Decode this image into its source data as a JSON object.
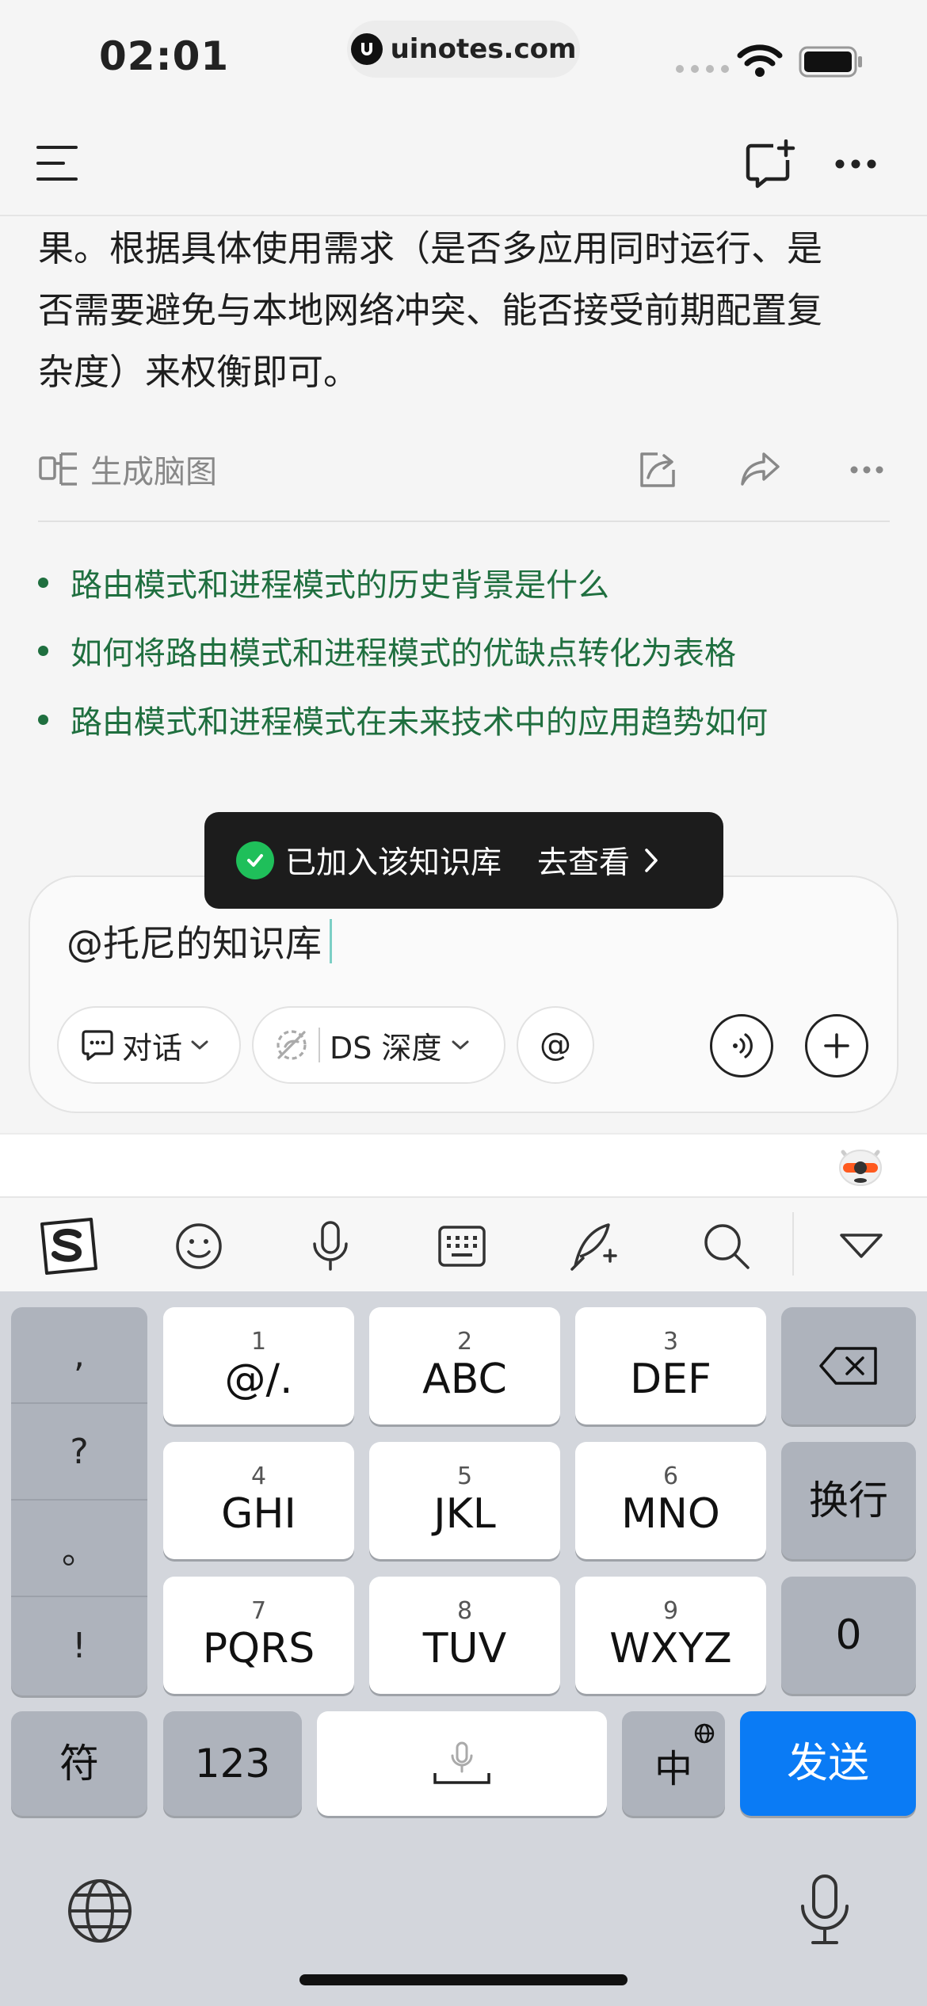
{
  "status": {
    "time": "02:01",
    "site": "uinotes.com"
  },
  "content": {
    "lines": [
      "果。根据具体使用需求（是否多应用同时运行、是",
      "否需要避免与本地网络冲突、能否接受前期配置复",
      "杂度）来权衡即可。"
    ],
    "mindmap_label": "生成脑图",
    "suggestions": [
      "路由模式和进程模式的历史背景是什么",
      "如何将路由模式和进程模式的优缺点转化为表格",
      "路由模式和进程模式在未来技术中的应用趋势如何"
    ]
  },
  "toast": {
    "message": "已加入该知识库",
    "action": "去查看"
  },
  "composer": {
    "text": "@托尼的知识库",
    "mode_label": "对话",
    "model_label": "DS 深度",
    "at_label": "@"
  },
  "keyboard": {
    "side": [
      ",",
      "?",
      "。",
      "!"
    ],
    "keys": [
      {
        "num": "1",
        "label": "@/."
      },
      {
        "num": "2",
        "label": "ABC"
      },
      {
        "num": "3",
        "label": "DEF"
      },
      {
        "num": "4",
        "label": "GHI"
      },
      {
        "num": "5",
        "label": "JKL"
      },
      {
        "num": "6",
        "label": "MNO"
      },
      {
        "num": "7",
        "label": "PQRS"
      },
      {
        "num": "8",
        "label": "TUV"
      },
      {
        "num": "9",
        "label": "WXYZ"
      }
    ],
    "newline": "换行",
    "zero": "0",
    "symbols": "符",
    "numbers": "123",
    "lang": "中",
    "send": "发送"
  },
  "colors": {
    "accent_green": "#1f6f3f",
    "send_blue": "#0a7bf5",
    "toast_ok": "#1fbf5a"
  }
}
